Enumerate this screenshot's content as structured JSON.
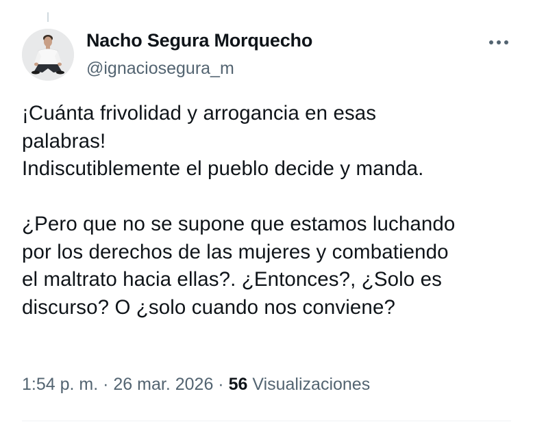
{
  "author": {
    "name": "Nacho Segura Morquecho",
    "handle": "@ignaciosegura_m"
  },
  "tweet": {
    "text": "¡Cuánta frivolidad y arrogancia en esas\npalabras!\nIndiscutiblemente el pueblo decide y manda.\n\n¿Pero que no se supone que estamos luchando\npor los derechos de las mujeres y combatiendo\nel maltrato hacia ellas?. ¿Entonces?, ¿Solo es\ndiscurso? O ¿solo cuando nos conviene?",
    "time": "1:54 p. m.",
    "date": "26 mar. 2026",
    "separator": "·",
    "views_count": "56",
    "views_label": "Visualizaciones"
  },
  "icons": {
    "more": "more-horizontal-icon"
  },
  "colors": {
    "text": "#0f1419",
    "secondary": "#536471"
  }
}
